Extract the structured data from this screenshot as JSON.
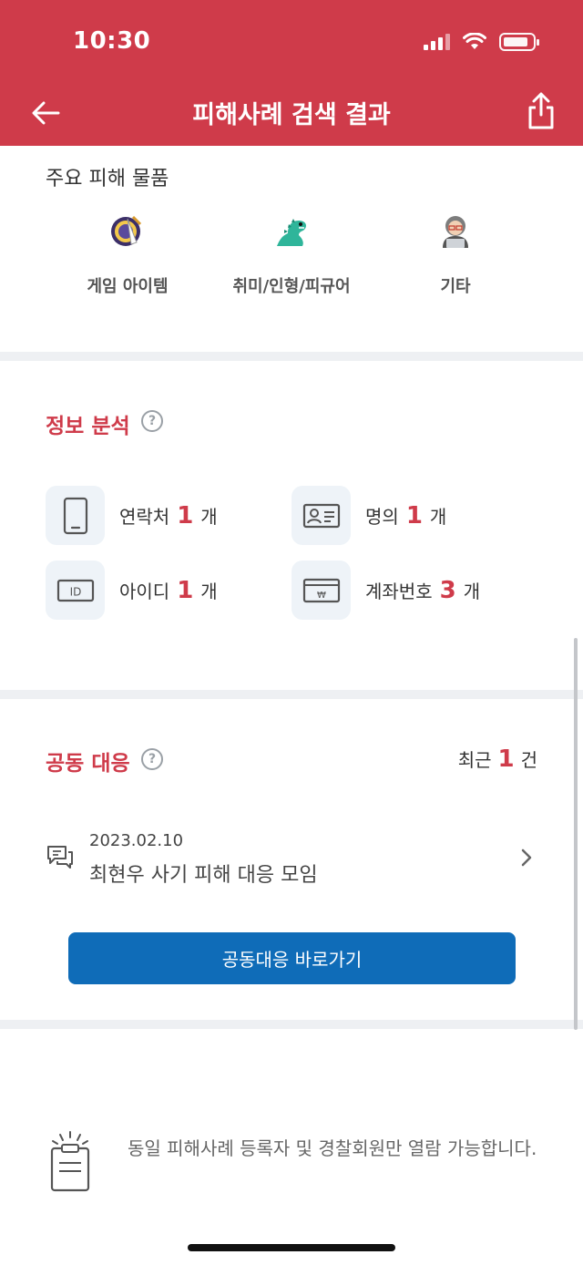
{
  "status_bar": {
    "time": "10:30"
  },
  "header": {
    "title": "피해사례 검색 결과"
  },
  "items_section": {
    "caption": "주요 피해 물품",
    "items": [
      {
        "label": "게임 아이템",
        "icon": "game-item-emoji-icon"
      },
      {
        "label": "취미/인형/피규어",
        "icon": "dinosaur-figure-emoji-icon"
      },
      {
        "label": "기타",
        "icon": "person-laptop-emoji-icon"
      }
    ]
  },
  "info_analysis": {
    "title": "정보 분석",
    "help": "?",
    "cards": [
      {
        "label": "연락처",
        "count": "1",
        "unit": "개",
        "icon": "phone-icon"
      },
      {
        "label": "명의",
        "count": "1",
        "unit": "개",
        "icon": "id-card-icon"
      },
      {
        "label": "아이디",
        "count": "1",
        "unit": "개",
        "icon": "id-badge-icon"
      },
      {
        "label": "계좌번호",
        "count": "3",
        "unit": "개",
        "icon": "bank-account-icon"
      }
    ]
  },
  "joint_response": {
    "title": "공동 대응",
    "help": "?",
    "recent_label": "최근",
    "recent_count": "1",
    "recent_unit": "건",
    "post": {
      "date": "2023.02.10",
      "title": "최현우 사기 피해 대응 모임"
    },
    "button_label": "공동대응 바로가기"
  },
  "notice": {
    "text": "동일 피해사례 등록자 및 경찰회원만 열람 가능합니다."
  },
  "colors": {
    "brand": "#cf3b4a",
    "primary_button": "#0f6cb8",
    "card_bg": "#eef3f8"
  }
}
